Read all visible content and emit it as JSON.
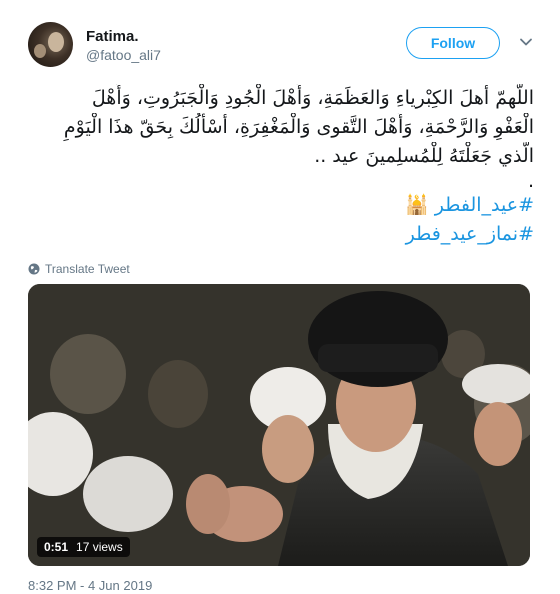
{
  "user": {
    "name": "Fatima.",
    "handle": "@fatoo_ali7"
  },
  "follow_button": {
    "label": "Follow"
  },
  "tweet": {
    "lines": [
      "اللّهمّ أهلَ الكِبْرياءِ وَالعَظَمَةِ، وَأَهْلَ الْجُودِ وَالْجَبَرُوتِ، وَأَهْلَ",
      "الْعَفْوِ وَالرَّحْمَةِ، وَأَهْلَ التَّقوى وَالْمَغْفِرَةِ، أسْأَلُكَ بِحَقّ هذَا الْيَوْمِ",
      "الّذي جَعَلْتَهُ لِلْمُسلِمينَ عيد .."
    ],
    "dot": ".",
    "hashtags": [
      "#عيد_الفطر 🕌",
      "#نماز_عید_فطر"
    ]
  },
  "translate": {
    "label": "Translate Tweet",
    "icon": "globe-icon"
  },
  "media": {
    "duration": "0:51",
    "views": "17 views"
  },
  "timestamp": "8:32 PM - 4 Jun 2019",
  "colors": {
    "link": "#1b95e0",
    "follow": "#1da1f2",
    "secondary": "#657786"
  }
}
